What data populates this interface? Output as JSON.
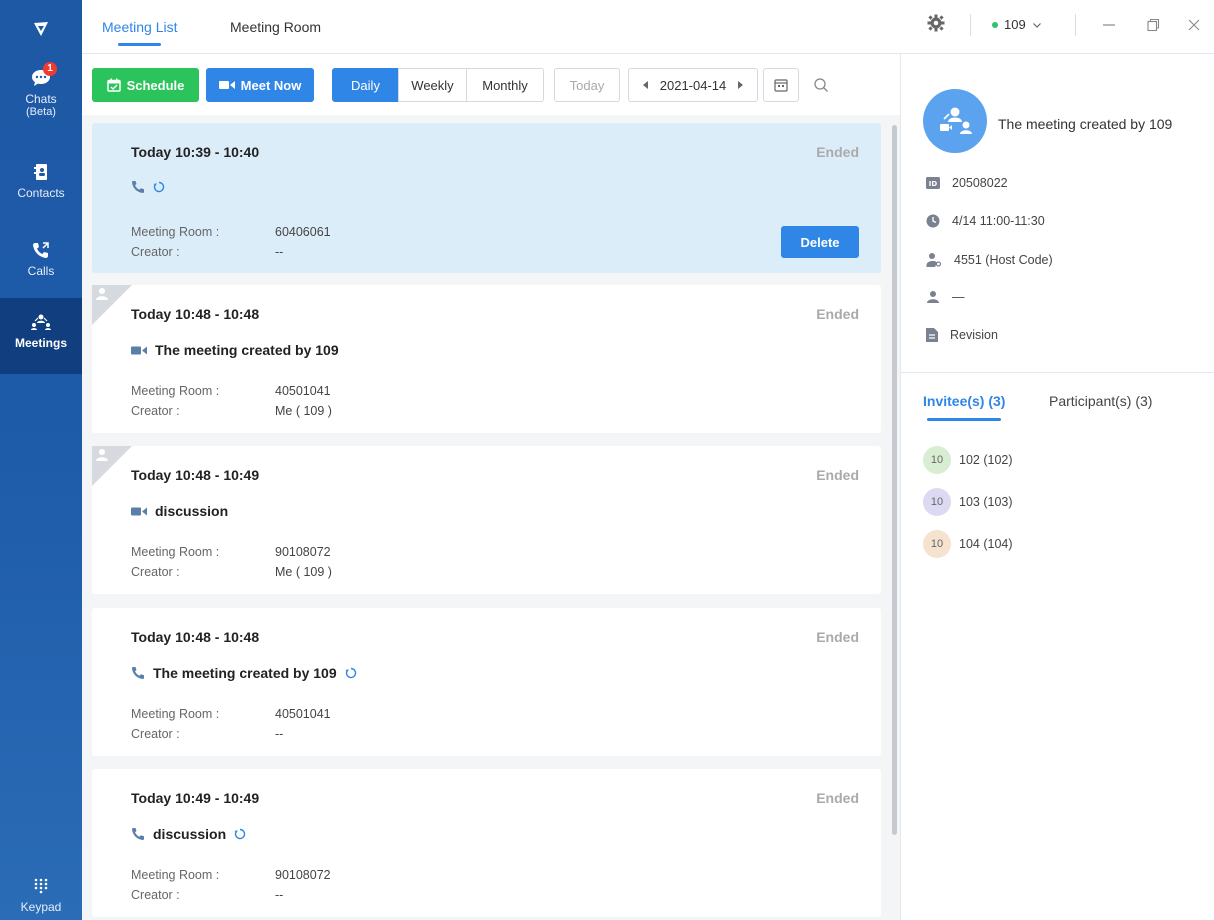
{
  "sidebar": {
    "items": [
      {
        "label": "Chats",
        "sub": "(Beta)",
        "badge": "1"
      },
      {
        "label": "Contacts"
      },
      {
        "label": "Calls"
      },
      {
        "label": "Meetings"
      },
      {
        "label": "Keypad"
      }
    ]
  },
  "topbar": {
    "tabs": [
      {
        "label": "Meeting List"
      },
      {
        "label": "Meeting Room"
      }
    ],
    "user": {
      "account": "109",
      "status_color": "#2bc36b"
    }
  },
  "toolbar": {
    "schedule_label": "Schedule",
    "meet_now_label": "Meet Now",
    "views": [
      "Daily",
      "Weekly",
      "Monthly"
    ],
    "today_label": "Today",
    "date": "2021-04-14"
  },
  "meetings": [
    {
      "time": "Today 10:39 - 10:40",
      "status": "Ended",
      "title": "",
      "room_label": "Meeting Room :",
      "room": "60406061",
      "creator_label": "Creator :",
      "creator": "--",
      "delete_label": "Delete"
    },
    {
      "time": "Today 10:48 - 10:48",
      "status": "Ended",
      "title": "The meeting created by 109",
      "room_label": "Meeting Room :",
      "room": "40501041",
      "creator_label": "Creator :",
      "creator": "Me ( 109 )"
    },
    {
      "time": "Today 10:48 - 10:49",
      "status": "Ended",
      "title": "discussion",
      "room_label": "Meeting Room :",
      "room": "90108072",
      "creator_label": "Creator :",
      "creator": "Me ( 109 )"
    },
    {
      "time": "Today 10:48 - 10:48",
      "status": "Ended",
      "title": "The meeting created by 109",
      "room_label": "Meeting Room :",
      "room": "40501041",
      "creator_label": "Creator :",
      "creator": "--"
    },
    {
      "time": "Today 10:49 - 10:49",
      "status": "Ended",
      "title": "discussion",
      "room_label": "Meeting Room :",
      "room": "90108072",
      "creator_label": "Creator :",
      "creator": "--"
    }
  ],
  "details": {
    "title": "The meeting created by 109",
    "id": "20508022",
    "time": "4/14 11:00-11:30",
    "host_code": "4551 (Host Code)",
    "creator": "—",
    "note": "Revision",
    "tabs": [
      {
        "label": "Invitee(s) (3)"
      },
      {
        "label": "Participant(s) (3)"
      }
    ],
    "invitees": [
      {
        "avatar": "10",
        "name": "102 (102)",
        "color": "#d9edd3"
      },
      {
        "avatar": "10",
        "name": "103 (103)",
        "color": "#dcdaf2"
      },
      {
        "avatar": "10",
        "name": "104 (104)",
        "color": "#f5e2cf"
      }
    ]
  },
  "colors": {
    "accent": "#2f86e6",
    "green": "#2bc35b",
    "sidebar": "#1e59a6"
  }
}
